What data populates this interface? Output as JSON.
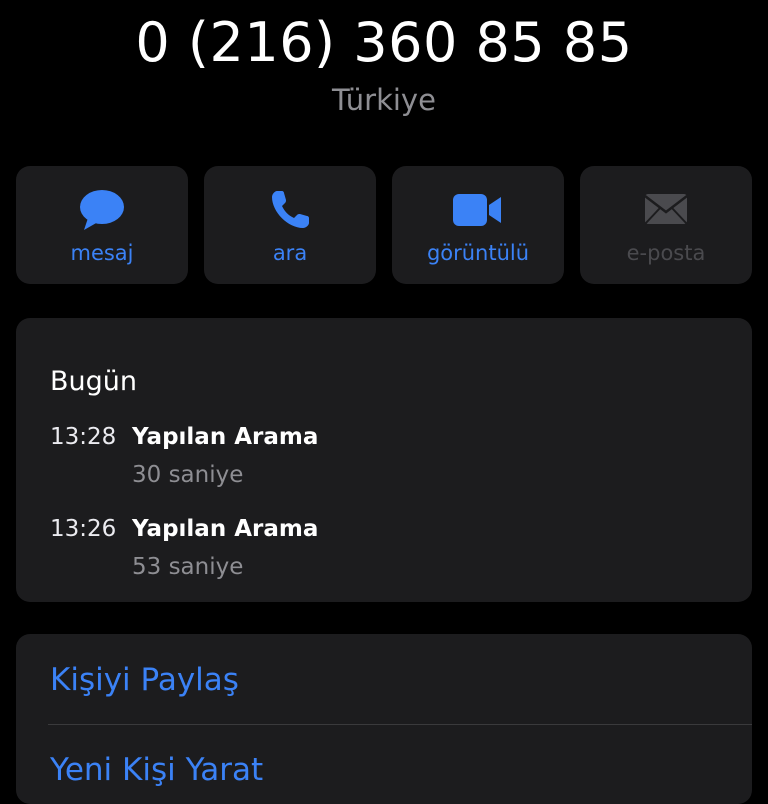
{
  "contact": {
    "phone": "0 (216) 360 85 85",
    "country": "Türkiye"
  },
  "actions": [
    {
      "label": "mesaj",
      "icon": "message-bubble-icon",
      "enabled": true
    },
    {
      "label": "ara",
      "icon": "phone-icon",
      "enabled": true
    },
    {
      "label": "görüntülü",
      "icon": "video-camera-icon",
      "enabled": true
    },
    {
      "label": "e-posta",
      "icon": "envelope-icon",
      "enabled": false
    }
  ],
  "recents": {
    "day": "Bugün",
    "entries": [
      {
        "time": "13:28",
        "type": "Yapılan Arama",
        "duration": "30 saniye"
      },
      {
        "time": "13:26",
        "type": "Yapılan Arama",
        "duration": "53 saniye"
      }
    ]
  },
  "options": {
    "share": "Kişiyi Paylaş",
    "create": "Yeni Kişi Yarat"
  },
  "colors": {
    "accent": "#3b82f6",
    "card": "#1c1c1e",
    "background": "#000000",
    "secondary_text": "#8e8e93"
  }
}
